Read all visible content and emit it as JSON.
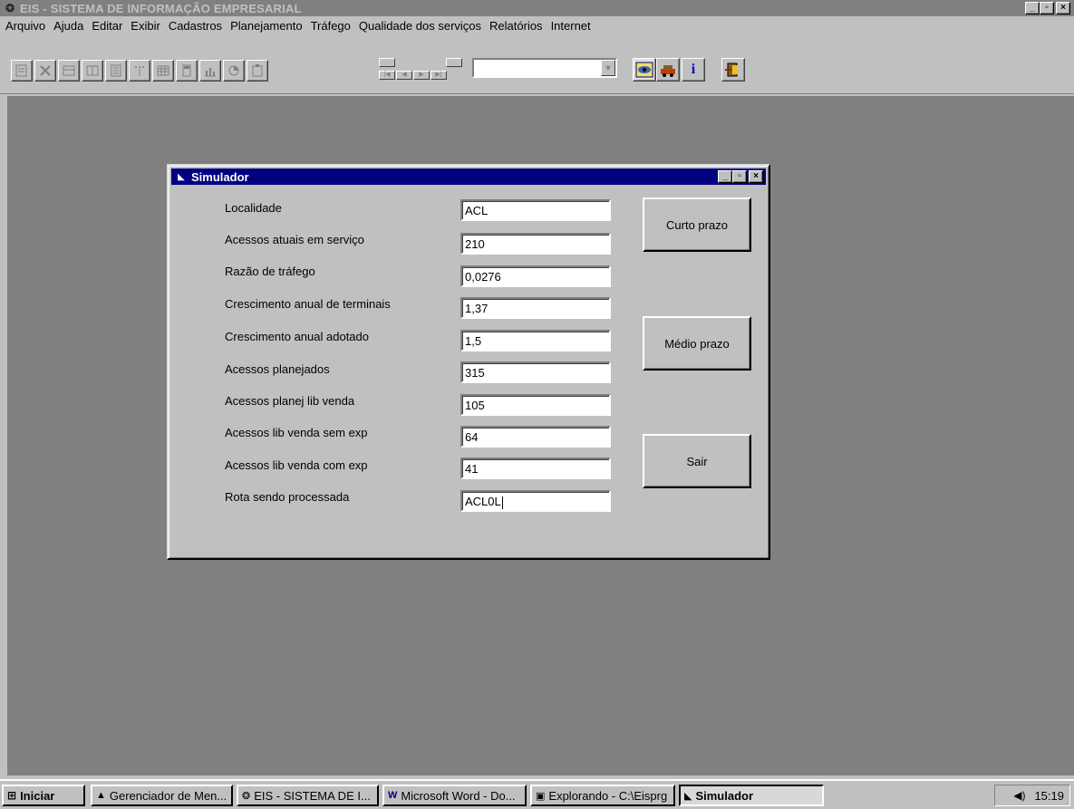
{
  "window": {
    "title": "EIS - SISTEMA DE INFORMAÇÃO EMPRESARIAL",
    "controls": [
      "_",
      "▫",
      "×"
    ]
  },
  "menu": [
    {
      "label": "Arquivo"
    },
    {
      "label": "Ajuda"
    },
    {
      "label": "Editar"
    },
    {
      "label": "Exibir"
    },
    {
      "label": "Cadastros"
    },
    {
      "label": "Planejamento"
    },
    {
      "label": "Tráfego"
    },
    {
      "label": "Qualidade dos serviços"
    },
    {
      "label": "Relatórios"
    },
    {
      "label": "Internet"
    }
  ],
  "toolbar": {
    "combo_value": "",
    "icons": [
      "print-preview-icon",
      "delete-icon",
      "form-icon",
      "form2-icon",
      "find-icon",
      "sort-icon",
      "table-icon",
      "calculator-icon",
      "bar-chart-icon",
      "pie-chart-icon",
      "properties-icon",
      "first-icon",
      "previous-icon",
      "next-icon",
      "last-icon",
      "eye-icon",
      "car-icon",
      "info-icon",
      "exit-icon"
    ]
  },
  "dialog": {
    "title": "Simulador",
    "fields": [
      {
        "label": "Localidade",
        "value": "ACL"
      },
      {
        "label": "Acessos atuais em serviço",
        "value": "210"
      },
      {
        "label": "Razão de tráfego",
        "value": "0,0276"
      },
      {
        "label": "Crescimento anual de terminais",
        "value": "1,37"
      },
      {
        "label": "Crescimento anual adotado",
        "value": "1,5"
      },
      {
        "label": "Acessos planejados",
        "value": "315"
      },
      {
        "label": "Acessos planej lib venda",
        "value": "105"
      },
      {
        "label": "Acessos lib venda sem exp",
        "value": "64"
      },
      {
        "label": "Acessos lib venda com exp",
        "value": "41"
      },
      {
        "label": "Rota sendo processada",
        "value": "ACL0L"
      }
    ],
    "buttons": {
      "short_term": "Curto prazo",
      "medium_term": "Médio prazo",
      "exit": "Sair"
    }
  },
  "taskbar": {
    "start": "Iniciar",
    "tasks": [
      {
        "label": "Gerenciador de Men..."
      },
      {
        "label": "EIS - SISTEMA DE I..."
      },
      {
        "label": "Microsoft Word - Do..."
      },
      {
        "label": "Explorando - C:\\Eisprg"
      },
      {
        "label": "Simulador"
      }
    ],
    "clock": "15:19"
  }
}
